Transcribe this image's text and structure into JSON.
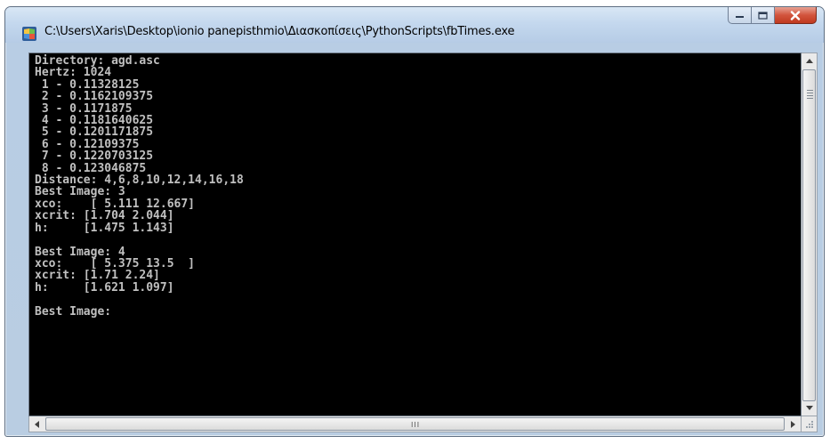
{
  "window": {
    "title": "C:\\Users\\Xaris\\Desktop\\ionio panepisthmio\\Διασκοπίσεις\\PythonScripts\\fbTimes.exe",
    "app_icon": "console-app-icon",
    "buttons": {
      "minimize": "minimize-icon",
      "maximize": "maximize-icon",
      "close": "close-icon"
    }
  },
  "console": {
    "background": "#000000",
    "text_color": "#c0c0c0",
    "text": "Directory: agd.asc\nHertz: 1024\n 1 - 0.11328125\n 2 - 0.1162109375\n 3 - 0.1171875\n 4 - 0.1181640625\n 5 - 0.1201171875\n 6 - 0.12109375\n 7 - 0.1220703125\n 8 - 0.123046875\nDistance: 4,6,8,10,12,14,16,18\nBest Image: 3\nxco:    [ 5.111 12.667]\nxcrit: [1.704 2.044]\nh:     [1.475 1.143]\n\nBest Image: 4\nxco:    [ 5.375 13.5  ]\nxcrit: [1.71 2.24]\nh:     [1.621 1.097]\n\nBest Image:"
  },
  "scrollbars": {
    "vertical": {
      "up": "scroll-up-arrow-icon",
      "down": "scroll-down-arrow-icon"
    },
    "horizontal": {
      "left": "scroll-left-arrow-icon",
      "right": "scroll-right-arrow-icon",
      "grip": "III"
    }
  }
}
